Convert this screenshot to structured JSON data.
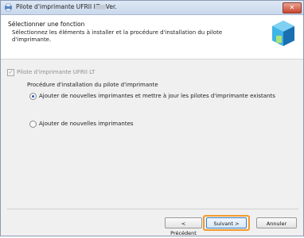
{
  "window": {
    "title": "Pilote d'imprimante UFRII LT - Ver."
  },
  "header": {
    "title": "Sélectionner une fonction",
    "description": "Sélectionnez les éléments à installer et la procédure d'installation du pilote d'imprimante."
  },
  "driver_option": {
    "label": "Pilote d'imprimante UFRII LT",
    "checked": true,
    "enabled": false
  },
  "procedure": {
    "title": "Procédure d'installation du pilote d'imprimante",
    "options": [
      {
        "label": "Ajouter de nouvelles imprimantes et mettre à jour les pilotes d'imprimante existants",
        "selected": true
      },
      {
        "label": "Ajouter de nouvelles imprimantes",
        "selected": false
      }
    ]
  },
  "buttons": {
    "back": "< Précédent",
    "next": "Suivant >",
    "cancel": "Annuler"
  },
  "colors": {
    "highlight": "#f39a2c",
    "primary_border": "#3a7fc8"
  }
}
